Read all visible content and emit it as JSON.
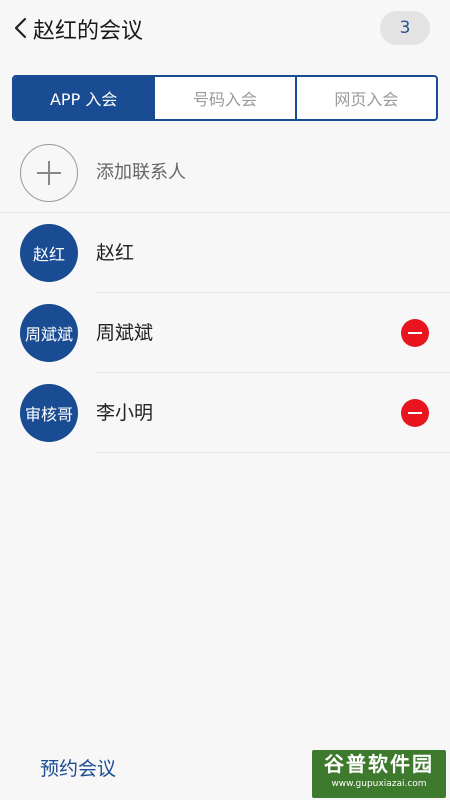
{
  "header": {
    "title": "赵红的会议",
    "participant_count": "3"
  },
  "tabs": [
    {
      "label": "APP 入会",
      "active": true
    },
    {
      "label": "号码入会",
      "active": false
    },
    {
      "label": "网页入会",
      "active": false
    }
  ],
  "add_contact": {
    "label": "添加联系人"
  },
  "participants": [
    {
      "avatar_text": "赵红",
      "name": "赵红",
      "removable": false
    },
    {
      "avatar_text": "周斌斌",
      "name": "周斌斌",
      "removable": true
    },
    {
      "avatar_text": "审核哥",
      "name": "李小明",
      "removable": true
    }
  ],
  "footer": {
    "schedule_label": "预约会议"
  },
  "watermark": {
    "brand": "谷普软件园",
    "url": "www.gupuxiazai.com"
  },
  "colors": {
    "brand_blue": "#1a4c94",
    "remove_red": "#e8141e",
    "background": "#f7f7f7"
  }
}
